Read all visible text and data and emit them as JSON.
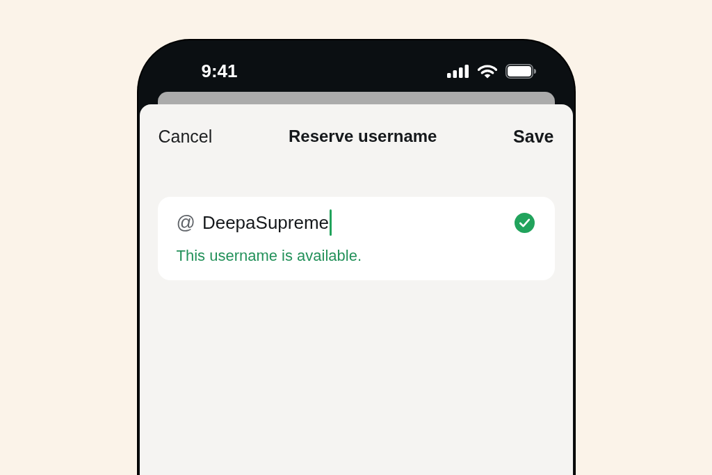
{
  "status_bar": {
    "time": "9:41"
  },
  "nav_bar": {
    "cancel": "Cancel",
    "title": "Reserve username",
    "save": "Save"
  },
  "username_field": {
    "prefix": "@",
    "value": "DeepaSupreme",
    "focused": true,
    "available": true,
    "message": "This username is available."
  }
}
